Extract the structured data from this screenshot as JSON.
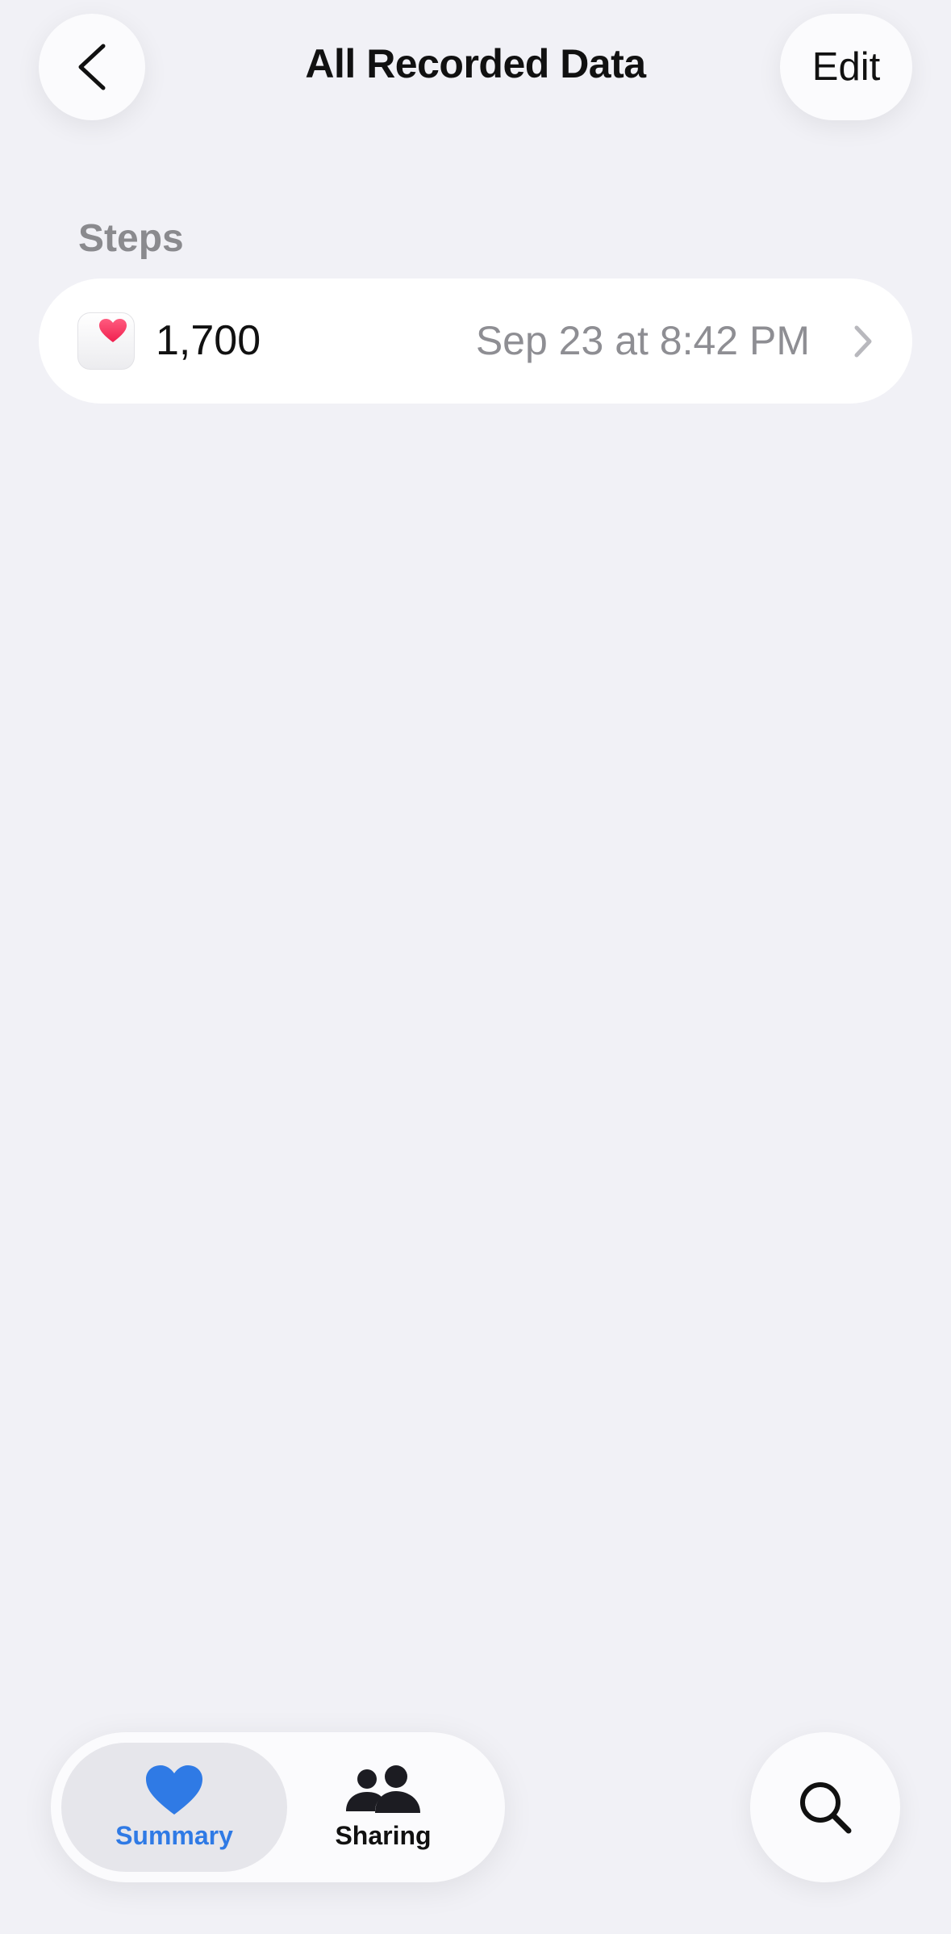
{
  "header": {
    "title": "All Recorded Data",
    "edit_label": "Edit"
  },
  "section": {
    "label": "Steps"
  },
  "records": [
    {
      "value": "1,700",
      "date": "Sep 23 at 8:42 PM",
      "icon": "health-app-heart-icon"
    }
  ],
  "tabs": [
    {
      "label": "Summary",
      "icon": "heart-icon",
      "active": true
    },
    {
      "label": "Sharing",
      "icon": "people-icon",
      "active": false
    }
  ],
  "colors": {
    "accent": "#2f7ae5",
    "heart": "#f5325c",
    "background": "#f1f1f6"
  }
}
